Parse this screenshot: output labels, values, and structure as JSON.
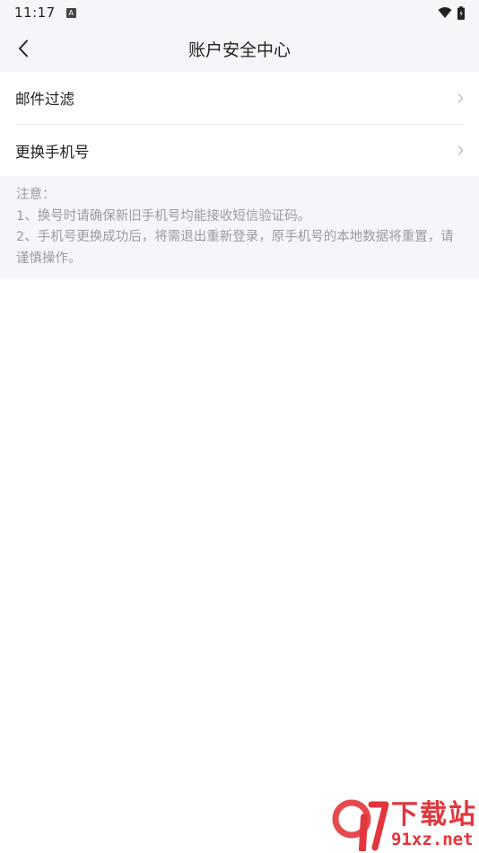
{
  "status_bar": {
    "time": "11:17",
    "notification_letter": "A"
  },
  "header": {
    "title": "账户安全中心"
  },
  "menu": {
    "items": [
      {
        "label": "邮件过滤"
      },
      {
        "label": "更换手机号"
      }
    ]
  },
  "notice": {
    "heading": "注意：",
    "lines": [
      "1、换号时请确保新旧手机号均能接收短信验证码。",
      "2、手机号更换成功后，将需退出重新登录，原手机号的本地数据将重置，请谨慎操作。"
    ]
  },
  "watermark": {
    "logo_text": "9",
    "cn": "下载站",
    "url": "91xz.net"
  },
  "colors": {
    "header_bg": "#f5f6fa",
    "notice_text": "#9a9ca3",
    "watermark_red": "#e2363c"
  }
}
